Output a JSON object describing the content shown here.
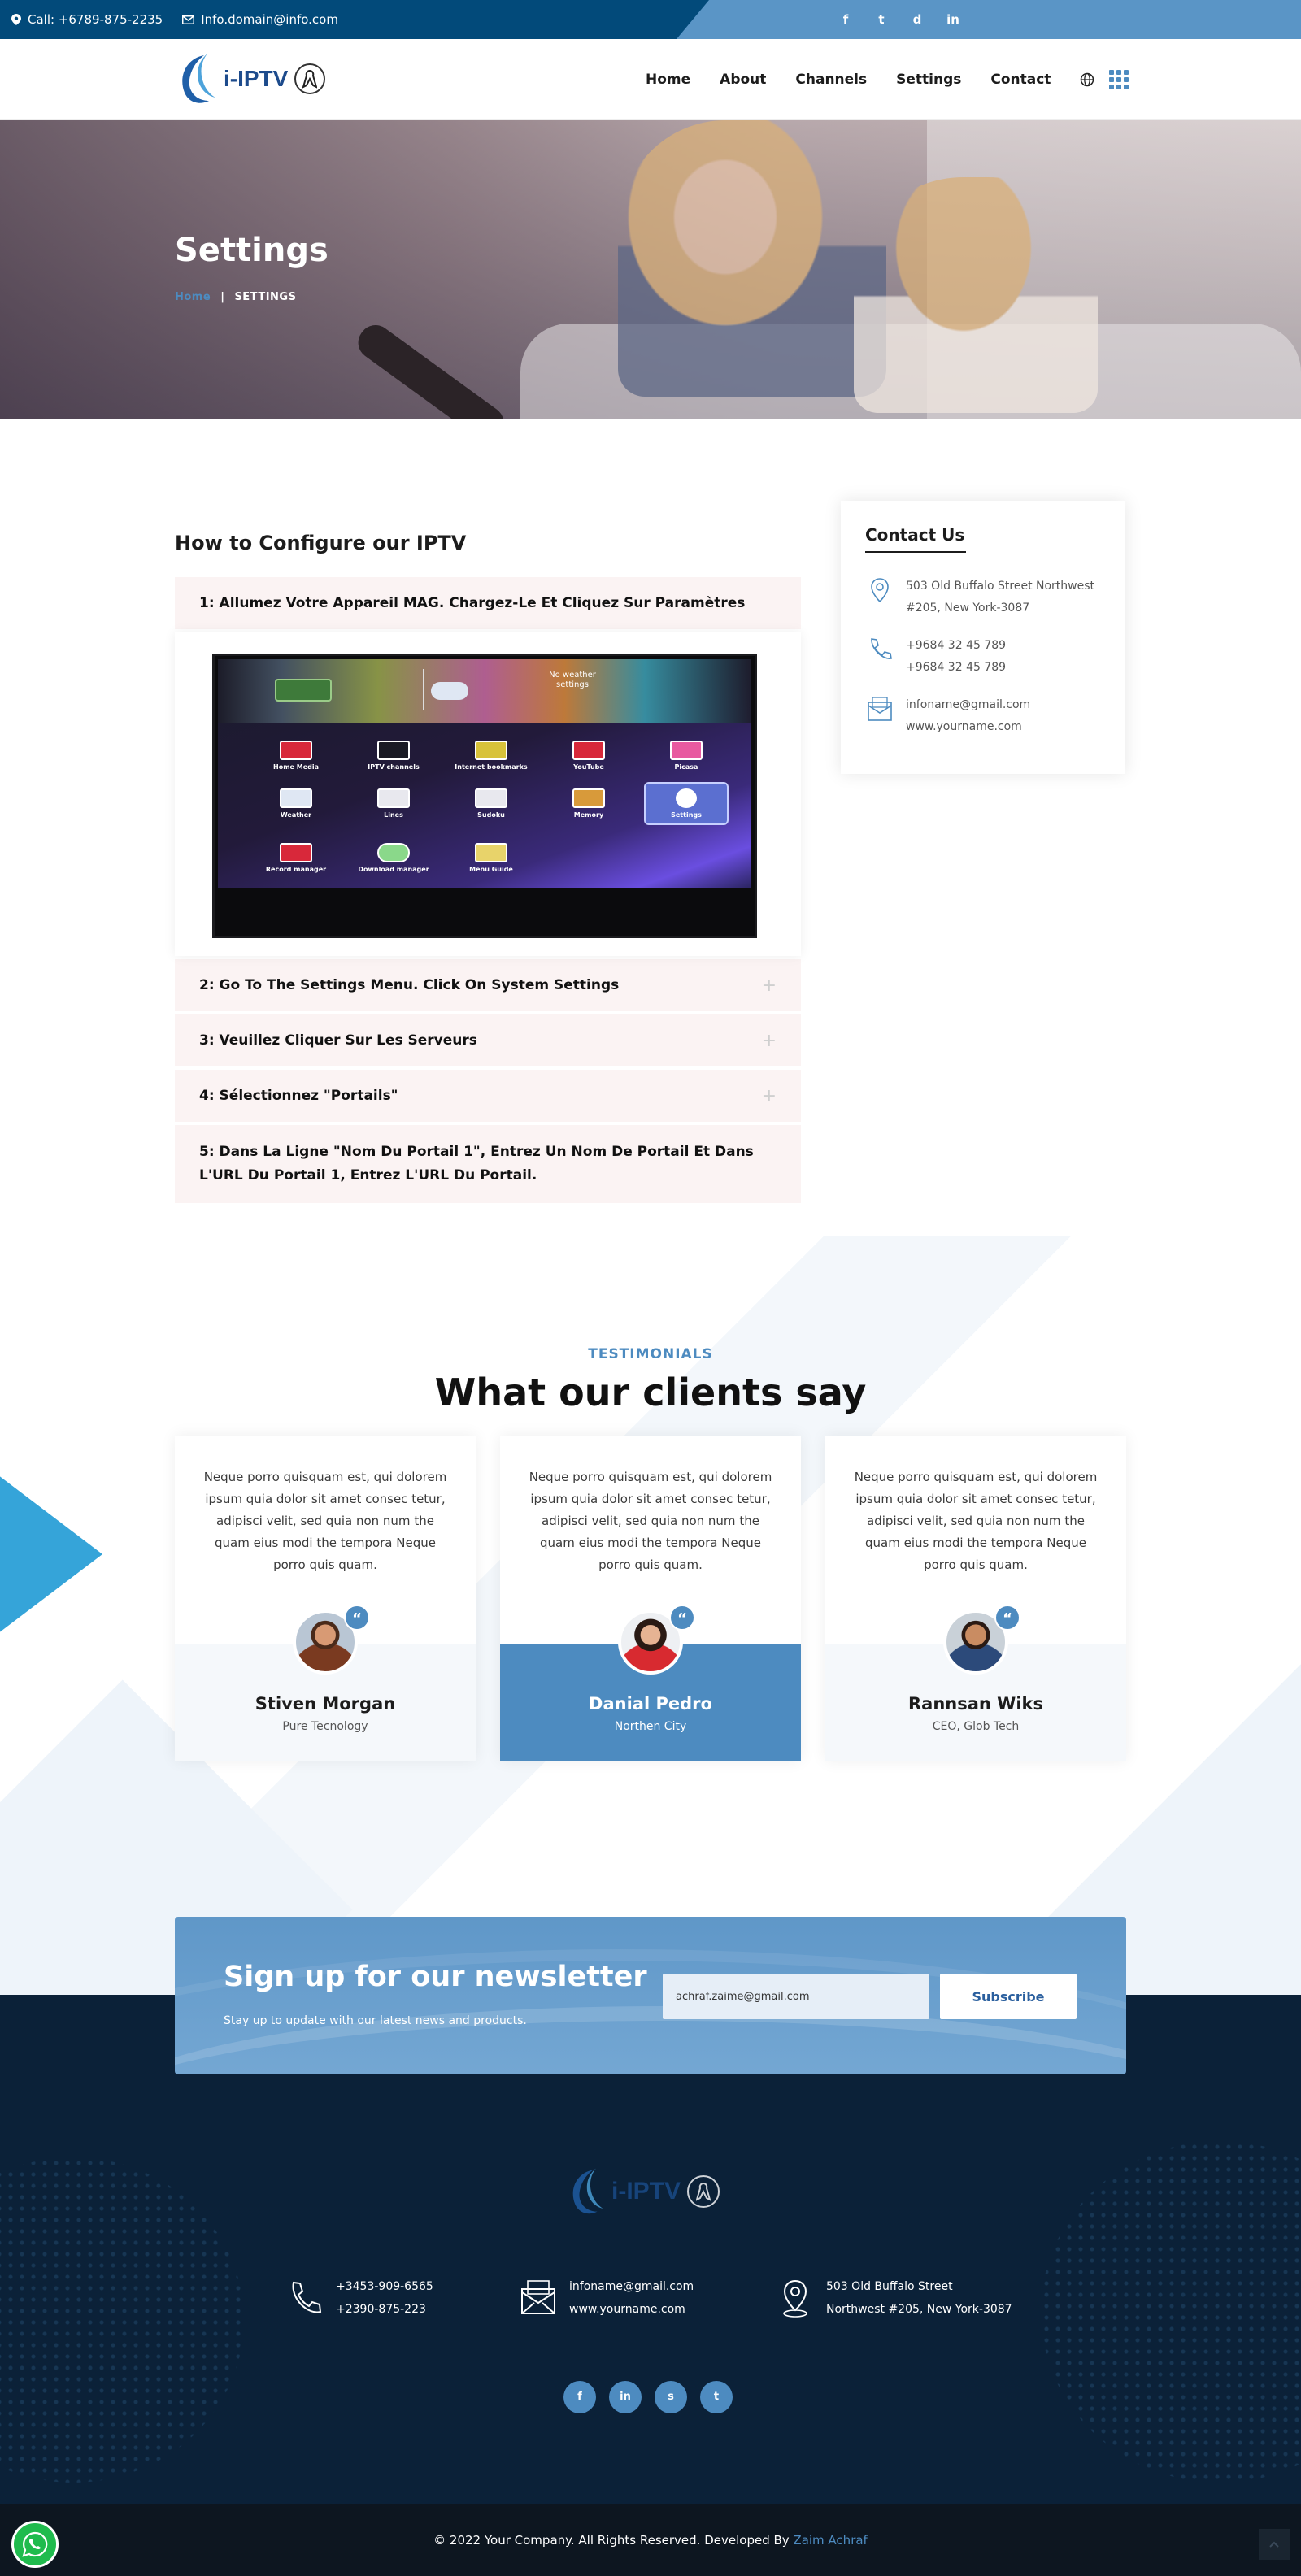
{
  "topbar": {
    "phone": "Call: +6789-875-2235",
    "email": "Info.domain@info.com",
    "social": [
      "f",
      "t",
      "d",
      "in"
    ]
  },
  "nav": {
    "logo_text": "i-IPTV",
    "items": [
      "Home",
      "About",
      "Channels",
      "Settings",
      "Contact"
    ],
    "globe_icon": "globe-icon",
    "apps_icon": "grid-icon"
  },
  "hero": {
    "title": "Settings",
    "breadcrumb_home": "Home",
    "breadcrumb_separator": "|",
    "breadcrumb_current": "SETTINGS"
  },
  "config": {
    "title": "How to Configure our IPTV",
    "steps": [
      "1: Allumez Votre Appareil MAG. Chargez-Le Et Cliquez Sur Paramètres",
      "2: Go To The Settings Menu. Click On System Settings",
      "3: Veuillez Cliquer Sur Les Serveurs",
      "4: Sélectionnez \"Portails\"",
      "5: Dans La Ligne \"Nom Du Portail 1\", Entrez Un Nom De Portail Et Dans L'URL Du Portail 1, Entrez L'URL Du Portail."
    ],
    "tv_menu": {
      "weather_label": "No weather settings",
      "tiles": [
        "Home Media",
        "IPTV channels",
        "Internet bookmarks",
        "YouTube",
        "Picasa",
        "Weather",
        "Lines",
        "Sudoku",
        "Memory",
        "Settings",
        "Record manager",
        "Download manager",
        "Menu Guide"
      ]
    }
  },
  "contact_card": {
    "title": "Contact Us",
    "address_1": "503 Old Buffalo Street Northwest",
    "address_2": "#205, New York-3087",
    "phone_1": "+9684 32 45 789",
    "phone_2": "+9684 32 45 789",
    "email": "infoname@gmail.com",
    "website": "www.yourname.com"
  },
  "testimonials": {
    "label": "TESTIMONIALS",
    "title": "What our clients say",
    "quote_mark": "“",
    "items": [
      {
        "quote": "Neque porro quisquam est, qui dolorem ipsum quia dolor sit amet consec tetur, adipisci velit, sed quia non num the quam eius modi the tempora Neque porro quis quam.",
        "name": "Stiven Morgan",
        "role": "Pure Tecnology"
      },
      {
        "quote": "Neque porro quisquam est, qui dolorem ipsum quia dolor sit amet consec tetur, adipisci velit, sed quia non num the quam eius modi the tempora Neque porro quis quam.",
        "name": "Danial Pedro",
        "role": "Northen City"
      },
      {
        "quote": "Neque porro quisquam est, qui dolorem ipsum quia dolor sit amet consec tetur, adipisci velit, sed quia non num the quam eius modi the tempora Neque porro quis quam.",
        "name": "Rannsan Wiks",
        "role": "CEO, Glob Tech"
      }
    ]
  },
  "newsletter": {
    "title": "Sign up for our newsletter",
    "subtitle": "Stay up to update with our latest news and products.",
    "input_value": "achraf.zaime@gmail.com",
    "button_label": "Subscribe"
  },
  "footer": {
    "logo_text": "i-IPTV",
    "phone_1": "+3453-909-6565",
    "phone_2": "+2390-875-223",
    "email": "infoname@gmail.com",
    "website": "www.yourname.com",
    "address_1": "503 Old Buffalo Street",
    "address_2": "Northwest #205, New York-3087",
    "social": [
      "f",
      "in",
      "s",
      "t"
    ]
  },
  "copyright": {
    "text": "© 2022 Your Company. All Rights Reserved. Developed By ",
    "developer": "Zaim Achraf"
  },
  "colors": {
    "primary": "#4d8bc0",
    "dark_navy": "#0b2138",
    "topbar_blue": "#024a7a",
    "whatsapp_green": "#1fbb4d"
  }
}
